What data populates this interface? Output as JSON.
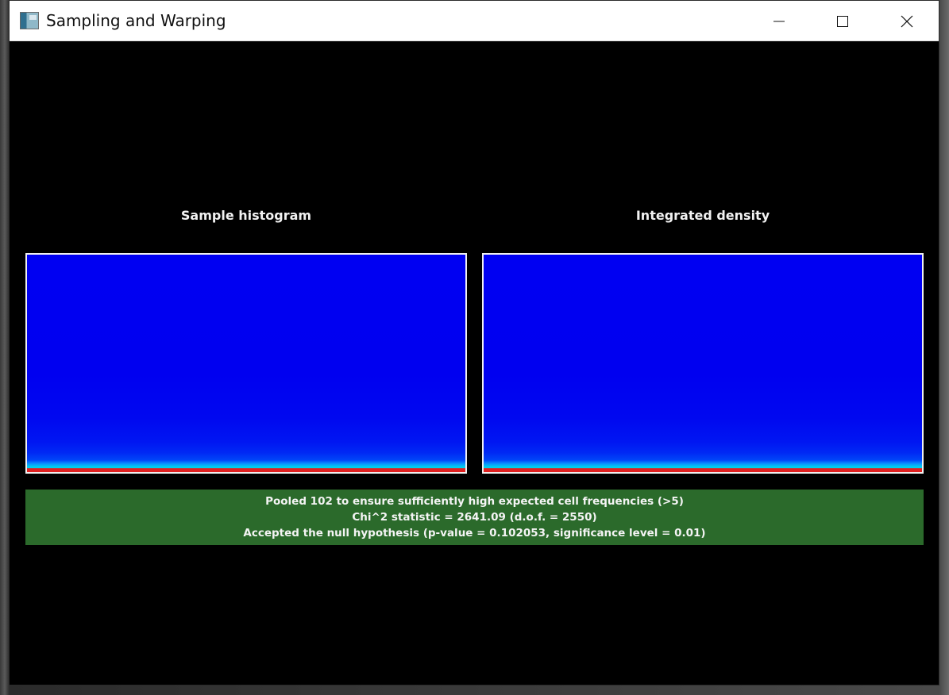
{
  "window": {
    "title": "Sampling and Warping"
  },
  "titlebar_buttons": {
    "minimize": "minimize-icon",
    "maximize": "maximize-icon",
    "close": "close-icon"
  },
  "panels": {
    "left_title": "Sample histogram",
    "right_title": "Integrated density"
  },
  "results": {
    "line1": "Pooled 102 to ensure sufficiently high expected cell frequencies (>5)",
    "line2": "Chi^2 statistic = 2641.09 (d.o.f. = 2550)",
    "line3": "Accepted the null hypothesis (p-value = 0.102053, significance level = 0.01)"
  },
  "colors": {
    "window_bg": "#000000",
    "result_bg": "#2b6a2b",
    "histogram_blue": "#0000f2",
    "histogram_cyan": "#00d2e8",
    "histogram_red": "#e02020"
  }
}
